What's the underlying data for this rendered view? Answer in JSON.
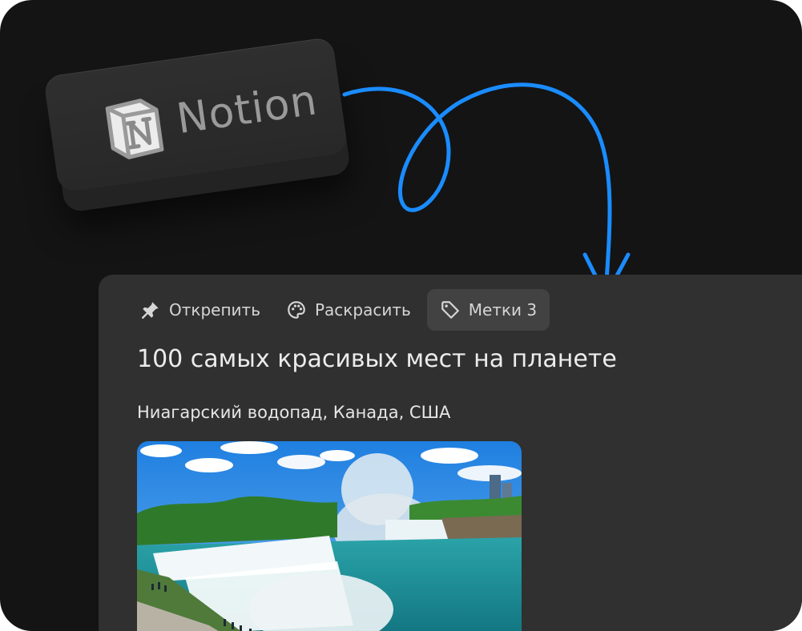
{
  "badge": {
    "brand_text": "Notion",
    "logo_icon": "notion-logo-icon"
  },
  "toolbar": {
    "unpin_label": "Открепить",
    "unpin_icon": "pin-icon",
    "color_label": "Раскрасить",
    "color_icon": "palette-icon",
    "tags_label": "Метки 3",
    "tags_icon": "tag-icon"
  },
  "page": {
    "title": "100 самых красивых мест на планете",
    "subtitle": "Ниагарский водопад, Канада, США",
    "image_icon": "waterfall-photo"
  },
  "colors": {
    "background": "#141414",
    "card": "#303030",
    "arrow": "#1a8cff",
    "active_tab": "#424242"
  }
}
